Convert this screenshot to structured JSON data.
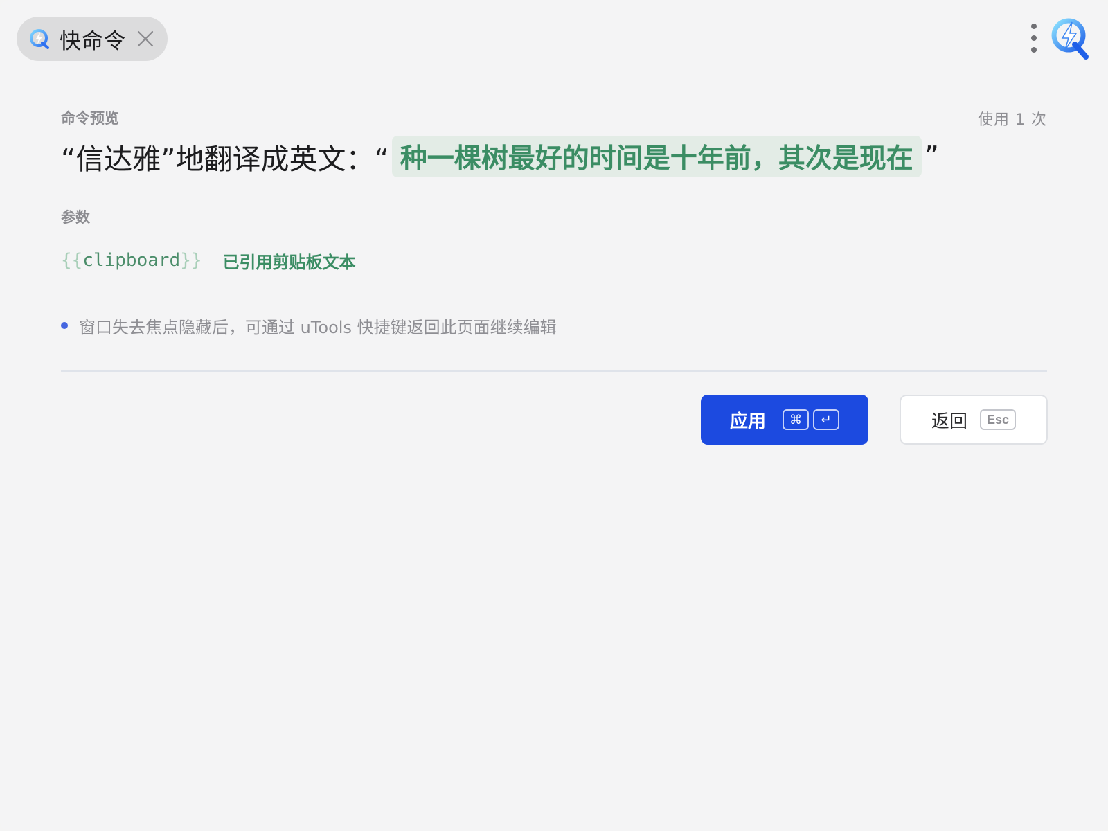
{
  "header": {
    "plugin_title": "快命令",
    "logo_icon": "utools-lightning-logo-icon",
    "close_icon": "close-icon",
    "menu_icon": "more-vertical-icon"
  },
  "preview": {
    "label": "命令预览",
    "usage": "使用 1 次",
    "prefix": "“信达雅”地翻译成英文：“",
    "highlight": "种一棵树最好的时间是十年前，其次是现在",
    "suffix": "”"
  },
  "params": {
    "label": "参数",
    "token_open": "{{",
    "token_name": "clipboard",
    "token_close": "}}",
    "description": "已引用剪贴板文本"
  },
  "tip": {
    "text": "窗口失去焦点隐藏后，可通过 uTools 快捷键返回此页面继续编辑"
  },
  "actions": {
    "apply_label": "应用",
    "apply_key1": "⌘",
    "apply_key2": "↵",
    "back_label": "返回",
    "back_key": "Esc"
  },
  "colors": {
    "accent_blue": "#1c4ae0",
    "highlight_green": "#3b8d64",
    "highlight_bg": "#e3ece6",
    "tip_dot": "#4566e0"
  }
}
